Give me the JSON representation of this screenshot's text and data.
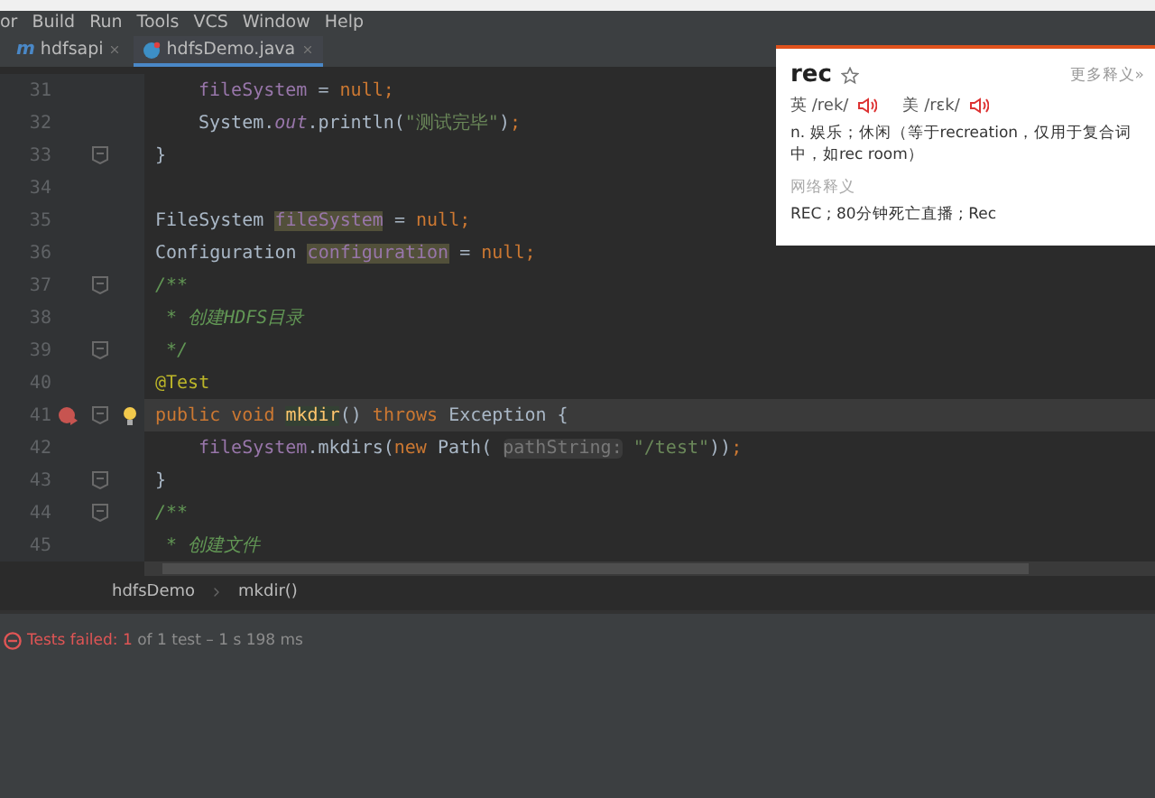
{
  "menu": [
    "or",
    "Build",
    "Run",
    "Tools",
    "VCS",
    "Window",
    "Help"
  ],
  "tabs": [
    {
      "label": "hdfsapi",
      "kind": "module",
      "icon": "m",
      "selected": false
    },
    {
      "label": "hdfsDemo.java",
      "kind": "class",
      "selected": true
    }
  ],
  "lines": [
    {
      "number": "31",
      "fold": false,
      "current": false,
      "breakpoint": false,
      "bulb": false,
      "indented": true,
      "tokens": [
        {
          "kind": "field",
          "text": "fileSystem"
        },
        {
          "kind": "plain",
          "text": " = "
        },
        {
          "kind": "keyword",
          "text": "null;"
        }
      ]
    },
    {
      "number": "32",
      "fold": false,
      "current": false,
      "breakpoint": false,
      "bulb": false,
      "indented": true,
      "tokens": [
        {
          "kind": "plain",
          "text": "System."
        },
        {
          "kind": "static",
          "text": "out"
        },
        {
          "kind": "plain",
          "text": ".println("
        },
        {
          "kind": "string",
          "text": "\"测试完毕\""
        },
        {
          "kind": "plain",
          "text": ")"
        },
        {
          "kind": "keyword",
          "text": ";"
        }
      ]
    },
    {
      "number": "33",
      "fold": true,
      "current": false,
      "breakpoint": false,
      "bulb": false,
      "tokens": [
        {
          "kind": "plain",
          "text": "}"
        }
      ]
    },
    {
      "number": "34",
      "fold": false,
      "current": false,
      "breakpoint": false,
      "bulb": false
    },
    {
      "number": "35",
      "fold": false,
      "current": false,
      "breakpoint": false,
      "bulb": false,
      "tokens": [
        {
          "kind": "plain",
          "text": "FileSystem "
        },
        {
          "kind": "usage",
          "text": "fileSystem"
        },
        {
          "kind": "plain",
          "text": " = "
        },
        {
          "kind": "keyword",
          "text": "null;"
        }
      ]
    },
    {
      "number": "36",
      "fold": false,
      "current": false,
      "breakpoint": false,
      "bulb": false,
      "tokens": [
        {
          "kind": "plain",
          "text": "Configuration "
        },
        {
          "kind": "usage",
          "text": "configuration"
        },
        {
          "kind": "plain",
          "text": " = "
        },
        {
          "kind": "keyword",
          "text": "null;"
        }
      ]
    },
    {
      "number": "37",
      "fold": true,
      "current": false,
      "breakpoint": false,
      "bulb": false,
      "tokens": [
        {
          "kind": "doc",
          "text": "/**"
        }
      ]
    },
    {
      "number": "38",
      "fold": false,
      "current": false,
      "breakpoint": false,
      "bulb": false,
      "tokens": [
        {
          "kind": "doc",
          "text": " * 创建HDFS目录"
        }
      ]
    },
    {
      "number": "39",
      "fold": true,
      "current": false,
      "breakpoint": false,
      "bulb": false,
      "tokens": [
        {
          "kind": "doc",
          "text": " */"
        }
      ]
    },
    {
      "number": "40",
      "fold": false,
      "current": false,
      "breakpoint": false,
      "bulb": false,
      "tokens": [
        {
          "kind": "annotation",
          "text": "@Test"
        }
      ]
    },
    {
      "number": "41",
      "fold": true,
      "current": true,
      "breakpoint": true,
      "bulb": true,
      "tokens": [
        {
          "kind": "keyword",
          "text": "public void "
        },
        {
          "kind": "method",
          "text": "mkdir"
        },
        {
          "kind": "plain",
          "text": "() "
        },
        {
          "kind": "keyword",
          "text": "throws "
        },
        {
          "kind": "plain",
          "text": "Exception {"
        }
      ]
    },
    {
      "number": "42",
      "fold": false,
      "current": false,
      "breakpoint": false,
      "bulb": false,
      "indented": true,
      "tokens": [
        {
          "kind": "field",
          "text": "fileSystem"
        },
        {
          "kind": "plain",
          "text": ".mkdirs("
        },
        {
          "kind": "keyword",
          "text": "new "
        },
        {
          "kind": "plain",
          "text": "Path( "
        },
        {
          "kind": "hint",
          "text": "pathString:"
        },
        {
          "kind": "string",
          "text": " \"/test\""
        },
        {
          "kind": "plain",
          "text": "))"
        },
        {
          "kind": "keyword",
          "text": ";"
        }
      ]
    },
    {
      "number": "43",
      "fold": true,
      "current": false,
      "breakpoint": false,
      "bulb": false,
      "tokens": [
        {
          "kind": "plain",
          "text": "}"
        }
      ]
    },
    {
      "number": "44",
      "fold": true,
      "current": false,
      "breakpoint": false,
      "bulb": false,
      "tokens": [
        {
          "kind": "doc",
          "text": "/**"
        }
      ]
    },
    {
      "number": "45",
      "fold": false,
      "current": false,
      "breakpoint": false,
      "bulb": false,
      "tokens": [
        {
          "kind": "doc",
          "text": " * 创建文件"
        }
      ]
    }
  ],
  "breadcrumb": [
    "hdfsDemo",
    "mkdir()"
  ],
  "test_status": {
    "label": "Tests failed: ",
    "failed": "1",
    "rest": " of 1 test – 1 s 198 ms"
  },
  "dictionary": {
    "word": "rec",
    "more": "更多释义»",
    "pronunciations": [
      {
        "region": "英",
        "ipa": "/rek/"
      },
      {
        "region": "美",
        "ipa": "/rɛk/"
      }
    ],
    "definition": "n. 娱乐；休闲（等于recreation，仅用于复合词中，如rec room）",
    "web_heading": "网络释义",
    "web_meanings": "REC ; 80分钟死亡直播 ; Rec"
  }
}
